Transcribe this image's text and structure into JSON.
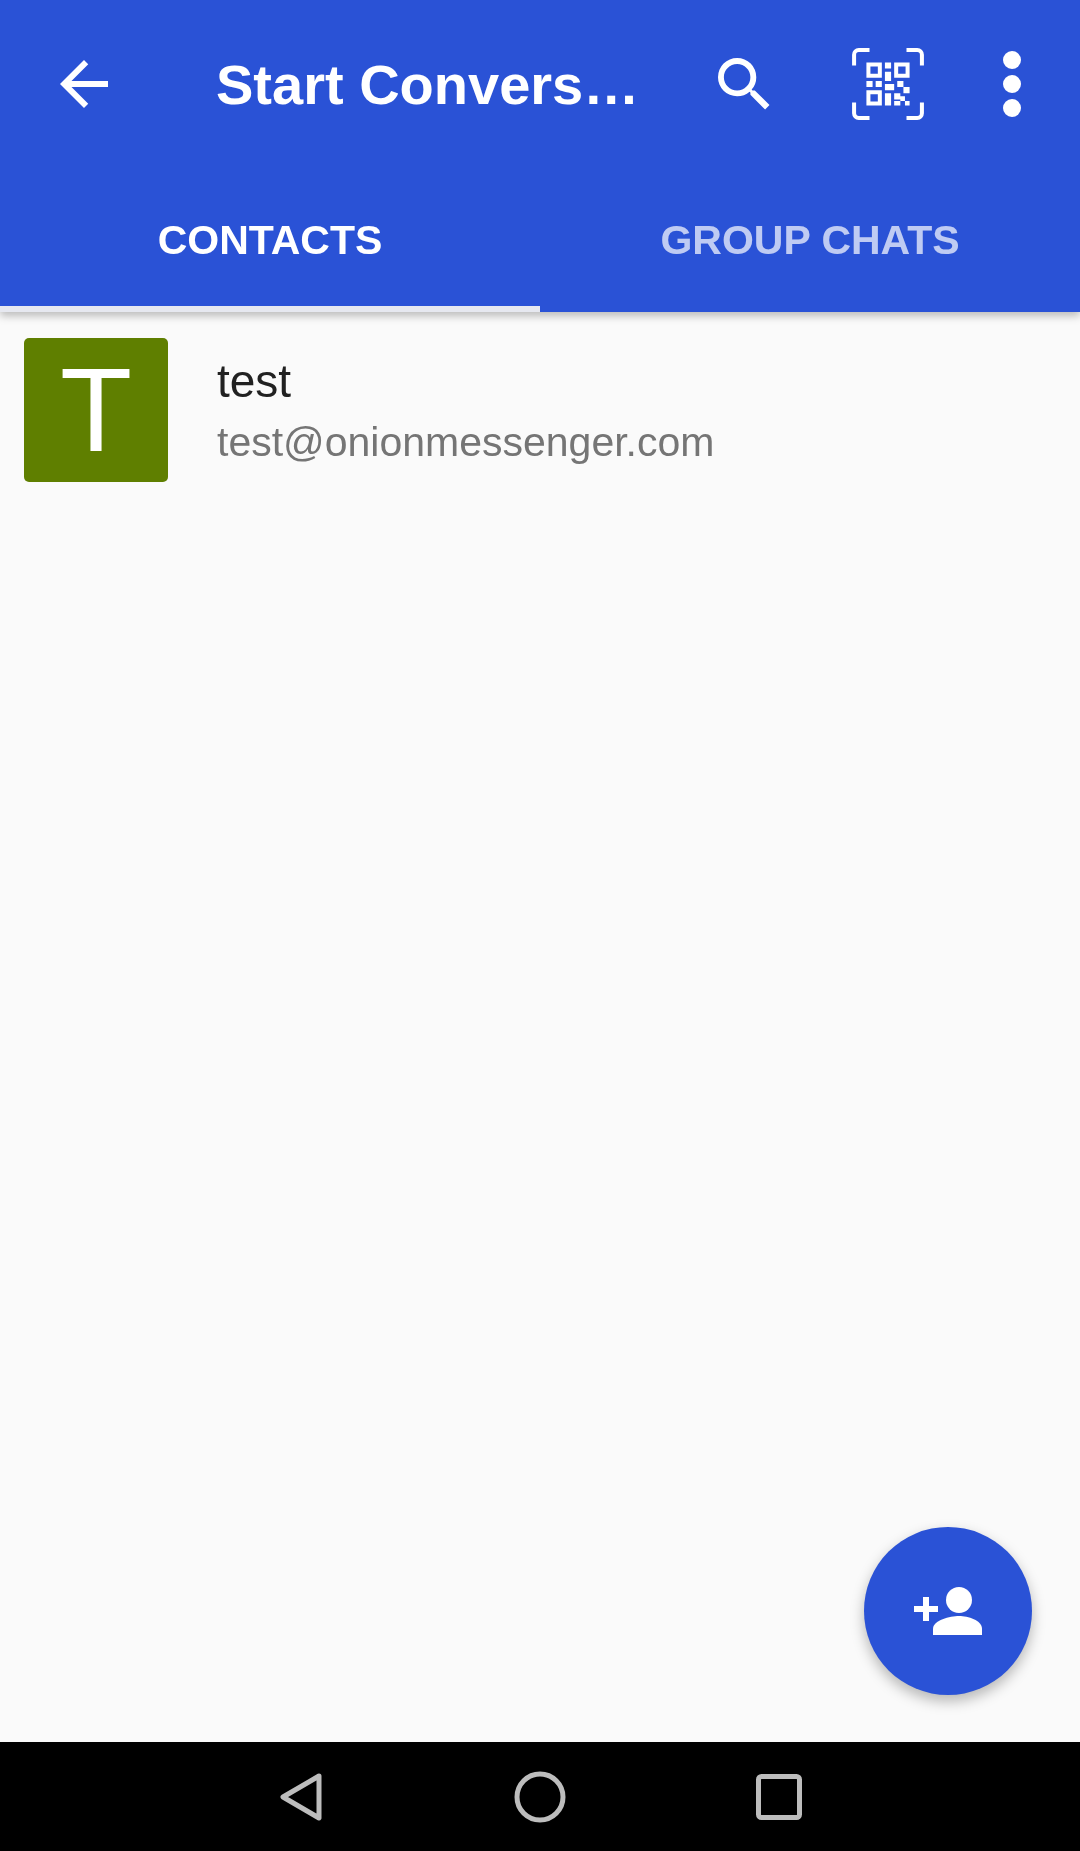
{
  "app_bar": {
    "title": "Start Convers…"
  },
  "tabs": [
    {
      "label": "CONTACTS",
      "selected": true
    },
    {
      "label": "GROUP CHATS",
      "selected": false
    }
  ],
  "contacts": [
    {
      "initial": "T",
      "name": "test",
      "address": "test@onionmessenger.com",
      "color": "#5f7f00"
    }
  ]
}
